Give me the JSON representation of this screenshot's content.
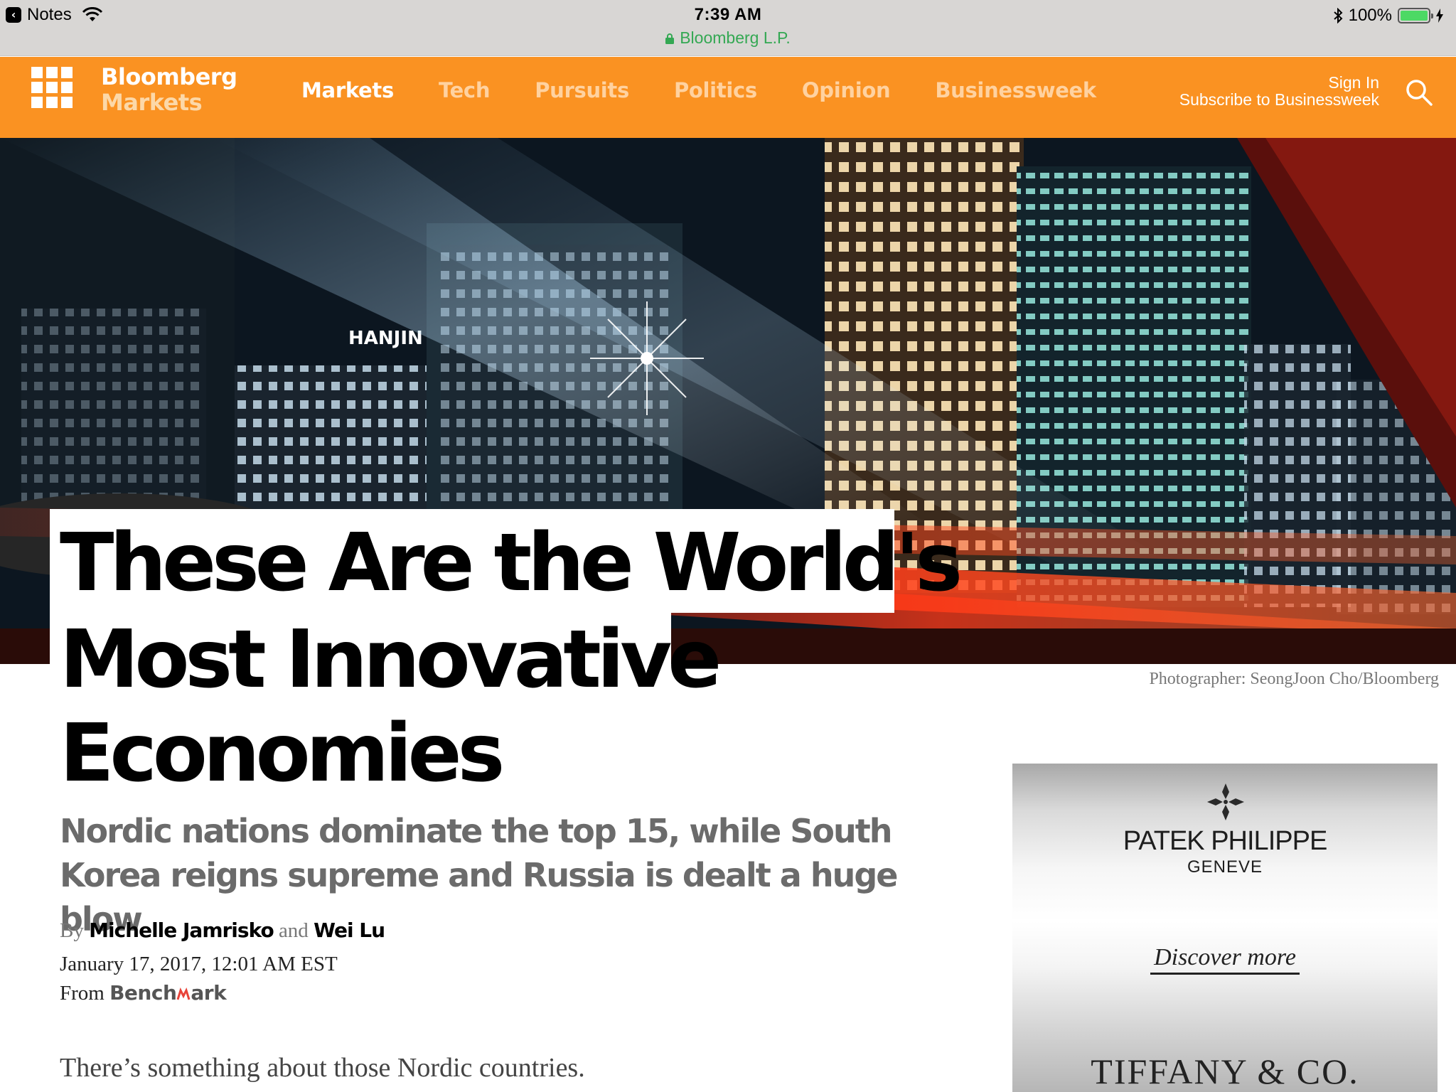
{
  "status_bar": {
    "back_app": "Notes",
    "time": "7:39 AM",
    "site": "Bloomberg L.P.",
    "battery": "100%",
    "battery_level": 1.0
  },
  "nav": {
    "brand_line1": "Bloomberg",
    "brand_line2": "Markets",
    "links": [
      "Markets",
      "Tech",
      "Pursuits",
      "Politics",
      "Opinion",
      "Businessweek"
    ],
    "sign_in": "Sign In",
    "subscribe": "Subscribe to Businessweek",
    "accent_color": "#fa9222"
  },
  "hero": {
    "sign_text": "HANJIN",
    "caption": "Photographer: SeongJoon Cho/Bloomberg"
  },
  "article": {
    "headline_line1": "These Are the World's",
    "headline_line2": "Most Innovative",
    "headline_line3": "Economies",
    "subhead": "Nordic nations dominate the top 15, while South Korea reigns supreme and Russia is dealt a huge blow",
    "by": "By",
    "author1": "Michelle Jamrisko",
    "and": "and",
    "author2": "Wei Lu",
    "date": "January 17, 2017, 12:01 AM EST",
    "from": "From",
    "source_part1": "Bench",
    "source_part2": "ark",
    "first_sentence": "There’s something about those Nordic countries."
  },
  "ad": {
    "brand": "PATEK PHILIPPE",
    "city": "GENEVE",
    "cta": "Discover more",
    "retailer": "TIFFANY & CO."
  }
}
